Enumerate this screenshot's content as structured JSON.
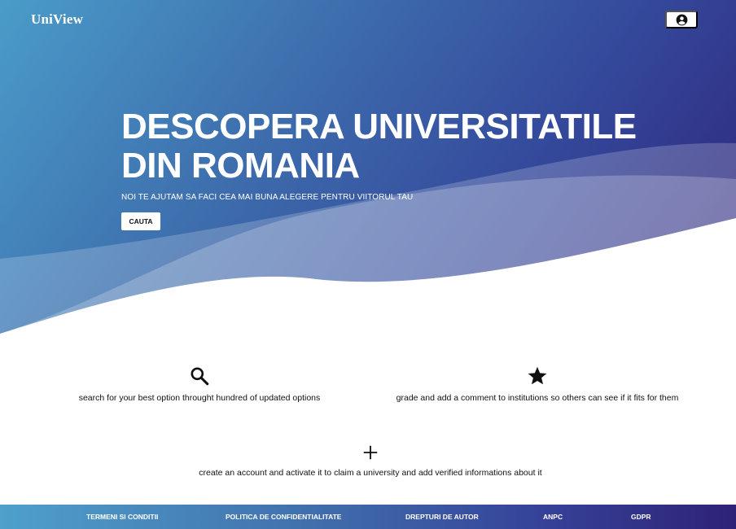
{
  "header": {
    "brand": "UniView",
    "account_icon": "account-circle-icon"
  },
  "hero": {
    "title_line1": "DESCOPERA UNIVERSITATILE",
    "title_line2": "DIN ROMANIA",
    "subtitle": "NOI TE AJUTAM SA FACI CEA MAI BUNA ALEGERE PENTRU VIITORUL TAU",
    "cta_label": "CAUTA"
  },
  "features": [
    {
      "icon": "search-icon",
      "text": "search for your best option throught hundred of updated options"
    },
    {
      "icon": "star-icon",
      "text": "grade and add a comment to institutions so others can see if it fits for them"
    },
    {
      "icon": "plus-icon",
      "text": "create an account and activate it to claim a university and add verified informations about it"
    }
  ],
  "footer": {
    "links": [
      "TERMENI SI CONDITII",
      "POLITICA DE CONFIDENTIALITATE",
      "DREPTURI DE AUTOR",
      "ANPC",
      "GDPR"
    ]
  },
  "colors": {
    "gradient_start": "#4a9cc9",
    "gradient_end": "#2e2277",
    "text_dark": "#111111",
    "white": "#ffffff"
  }
}
